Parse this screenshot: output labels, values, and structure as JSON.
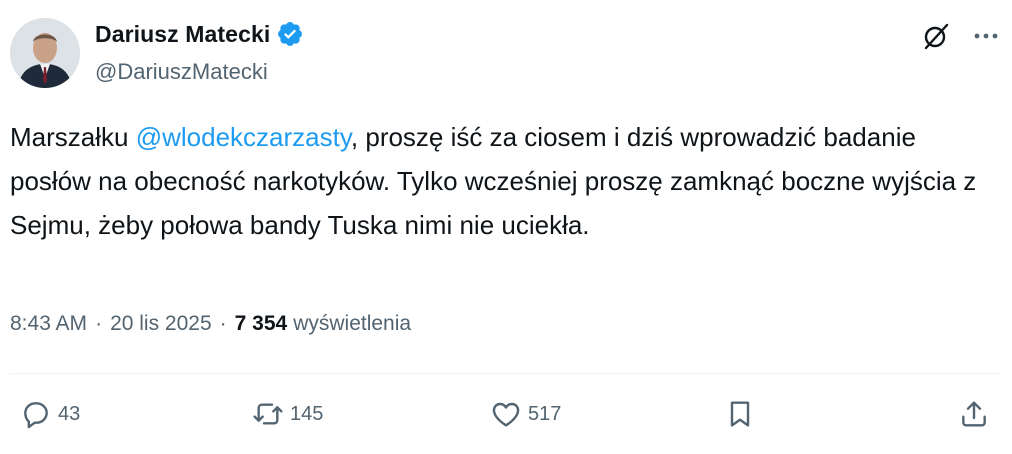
{
  "author": {
    "name": "Dariusz Matecki",
    "handle": "@DariuszMatecki",
    "verified": true
  },
  "tweet": {
    "text_before": "Marszałku ",
    "mention": "@wlodekczarzasty",
    "text_after": ", proszę iść za ciosem i dziś wprowadzić badanie posłów na obecność narkotyków. Tylko wcześniej proszę zamknąć boczne wyjścia z Sejmu, żeby połowa bandy Tuska nimi nie uciekła."
  },
  "meta": {
    "time": "8:43 AM",
    "separator": "·",
    "date": "20 lis 2025",
    "views_count": "7 354",
    "views_label": "wyświetlenia"
  },
  "actions": {
    "replies": "43",
    "reposts": "145",
    "likes": "517"
  },
  "icons": {
    "top": [
      "grok-icon",
      "more-icon"
    ],
    "actions": [
      "reply-icon",
      "repost-icon",
      "like-icon",
      "bookmark-icon",
      "share-icon"
    ]
  },
  "colors": {
    "accent": "#1d9bf0",
    "text": "#0f1419",
    "secondary": "#536471"
  }
}
